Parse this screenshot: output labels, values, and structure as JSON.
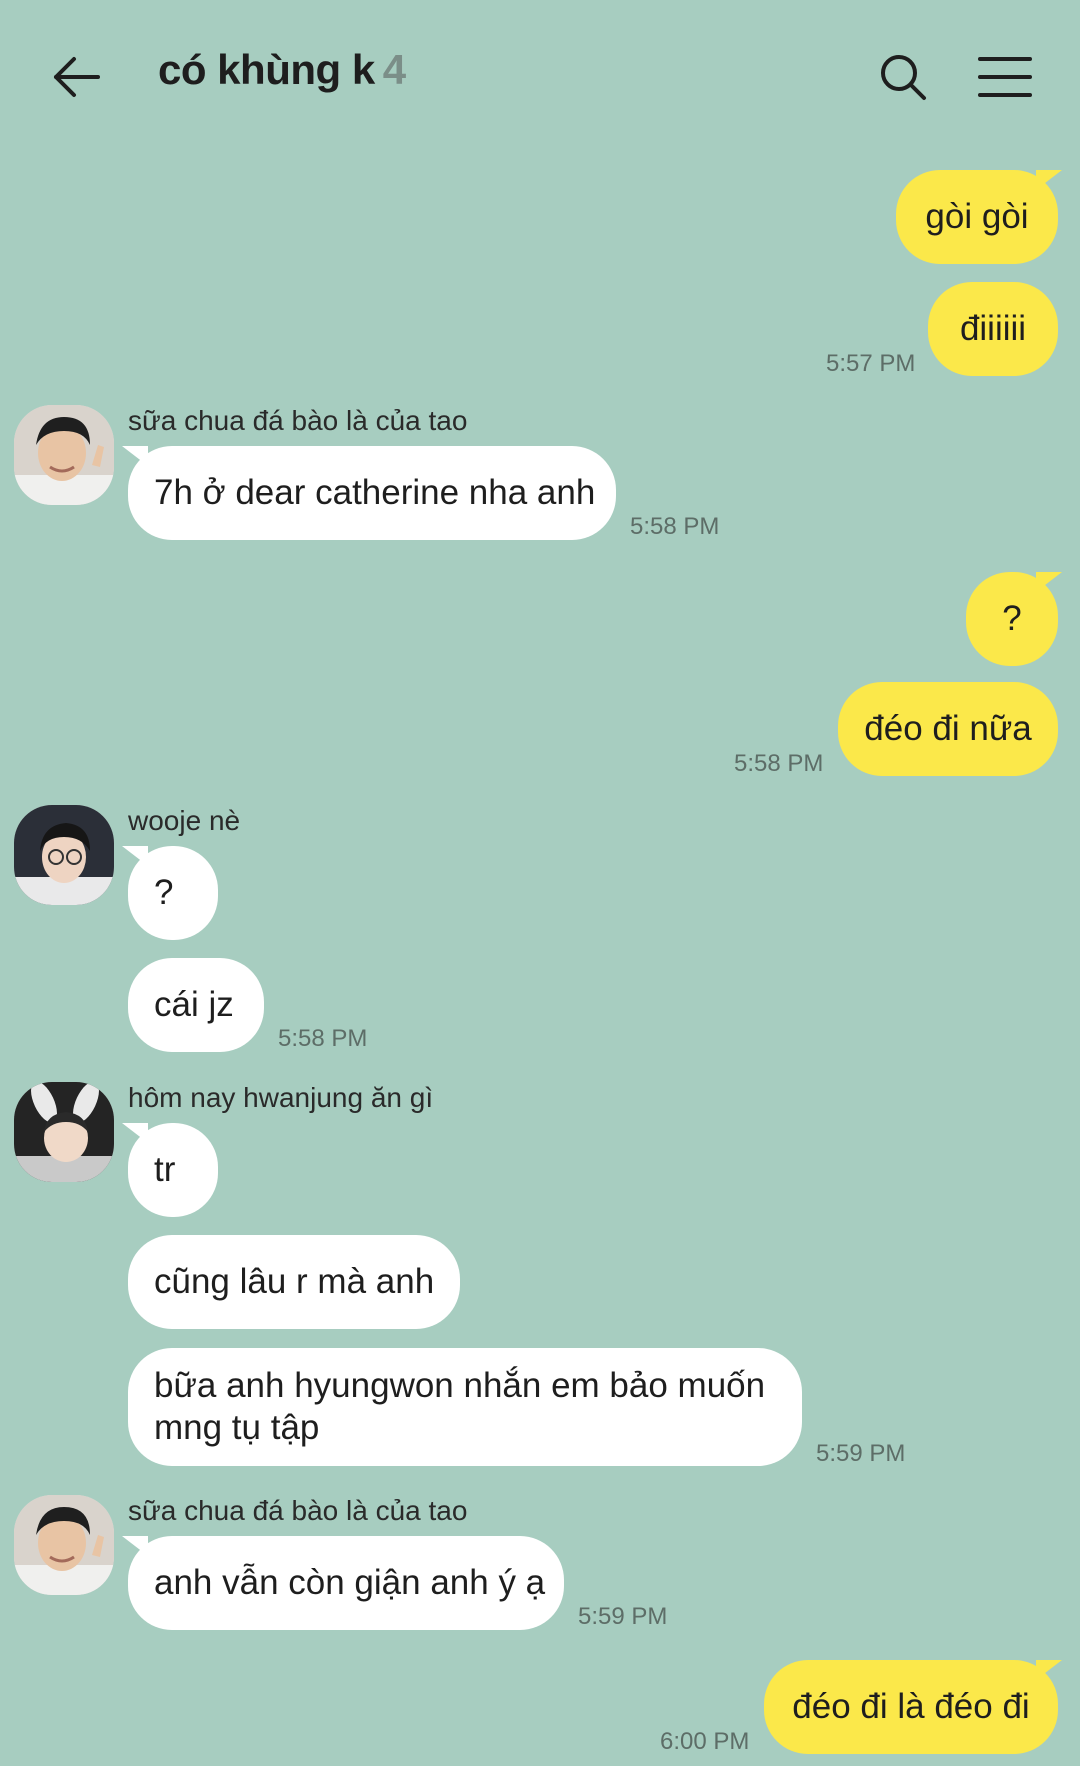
{
  "header": {
    "title": "có khùng k",
    "member_count": "4",
    "back_icon": "arrow-left-icon",
    "search_icon": "search-icon",
    "menu_icon": "hamburger-menu-icon"
  },
  "colors": {
    "background": "#a7cdc0",
    "outgoing_bubble": "#fbe84a",
    "incoming_bubble": "#ffffff"
  },
  "messages": {
    "m1": {
      "text": "gòi gòi"
    },
    "m2": {
      "text": "điiiiii",
      "time": "5:57 PM"
    },
    "g1": {
      "sender": "sữa chua đá bào là của tao",
      "text": "7h ở dear catherine nha anh",
      "time": "5:58 PM"
    },
    "m3": {
      "text": "?"
    },
    "m4": {
      "text": "đéo đi nữa",
      "time": "5:58 PM"
    },
    "g2": {
      "sender": "wooje nè",
      "text1": "?",
      "text2": "cái jz",
      "time": "5:58 PM"
    },
    "g3": {
      "sender": "hôm nay hwanjung ăn gì",
      "text1": "tr",
      "text2": "cũng lâu r mà anh",
      "text3": "bữa anh hyungwon nhắn em bảo muốn mng tụ tập",
      "time": "5:59 PM"
    },
    "g4": {
      "sender": "sữa chua đá bào là của tao",
      "text": "anh vẫn còn giận anh ý ạ",
      "time": "5:59 PM"
    },
    "m5": {
      "text": "đéo đi là đéo đi",
      "time": "6:00 PM"
    }
  }
}
